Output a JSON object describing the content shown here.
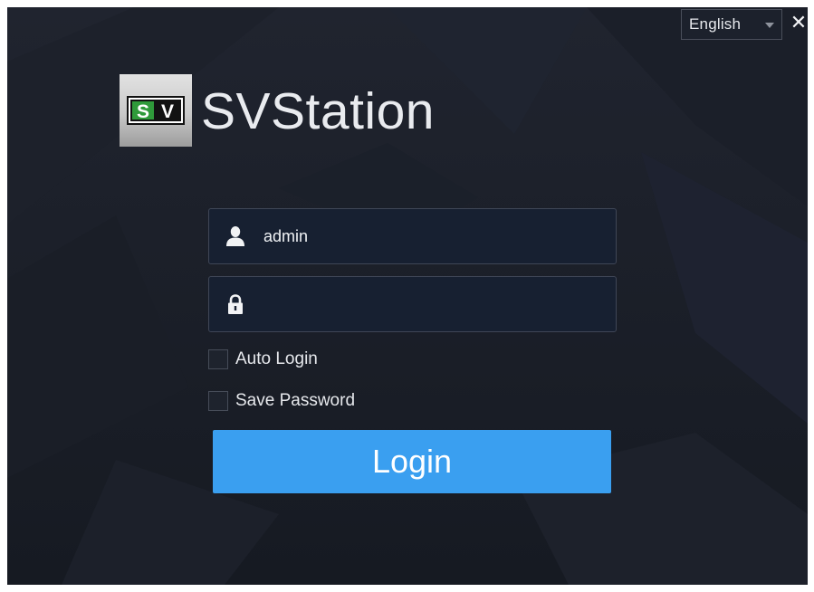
{
  "window": {
    "language": "English",
    "close_symbol": "✕"
  },
  "brand": {
    "logo_text": "SV",
    "title": "SVStation"
  },
  "login_form": {
    "username": {
      "icon": "user-icon",
      "value": "admin"
    },
    "password": {
      "icon": "lock-icon",
      "value": ""
    },
    "auto_login": {
      "label": "Auto Login",
      "checked": false
    },
    "save_password": {
      "label": "Save Password",
      "checked": false
    },
    "submit_label": "Login"
  },
  "colors": {
    "background": "#191d27",
    "button": "#3a9ff0",
    "logo_green": "#2f9a3a",
    "text": "#e9ebef"
  }
}
